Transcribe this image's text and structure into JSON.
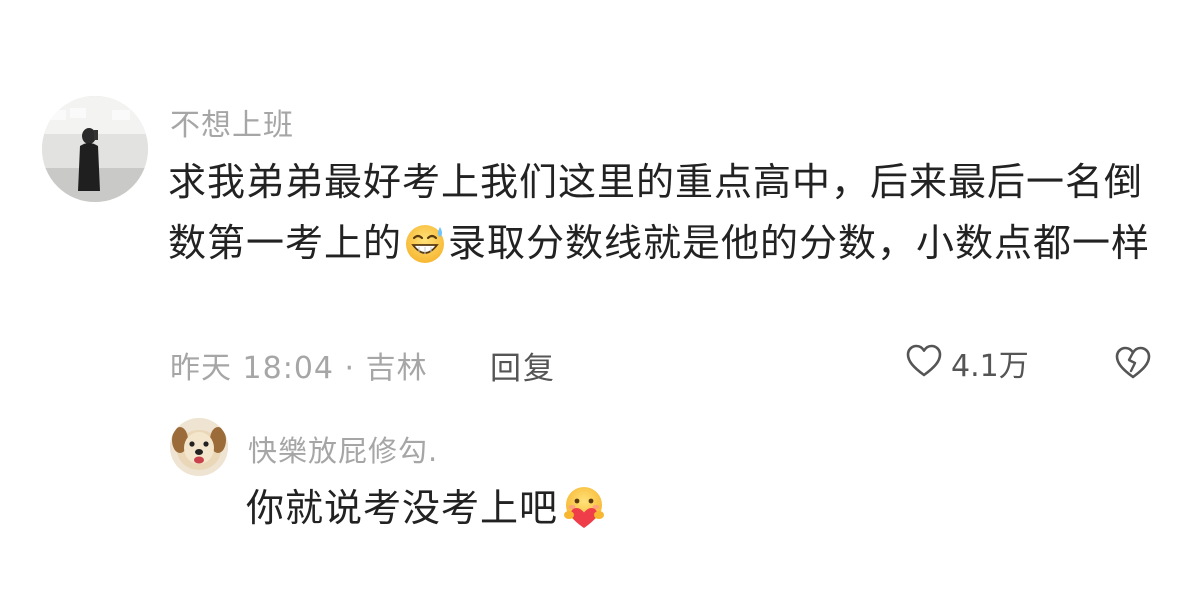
{
  "comment": {
    "username": "不想上班",
    "text_part1": "求我弟弟最好考上我们这里的重点高中，后来最后一名倒数第一考上的",
    "emoji": "grinning-sweat-emoji",
    "text_part2": "录取分数线就是他的分数，小数点都一样",
    "time_location": "昨天 18:04 · 吉林",
    "reply_label": "回复",
    "like_count": "4.1万"
  },
  "reply": {
    "username": "快樂放屁修勾.",
    "text": "你就说考没考上吧",
    "emoji": "heart-hug-emoji"
  },
  "icons": {
    "like": "heart-outline-icon",
    "dislike": "broken-heart-icon"
  }
}
